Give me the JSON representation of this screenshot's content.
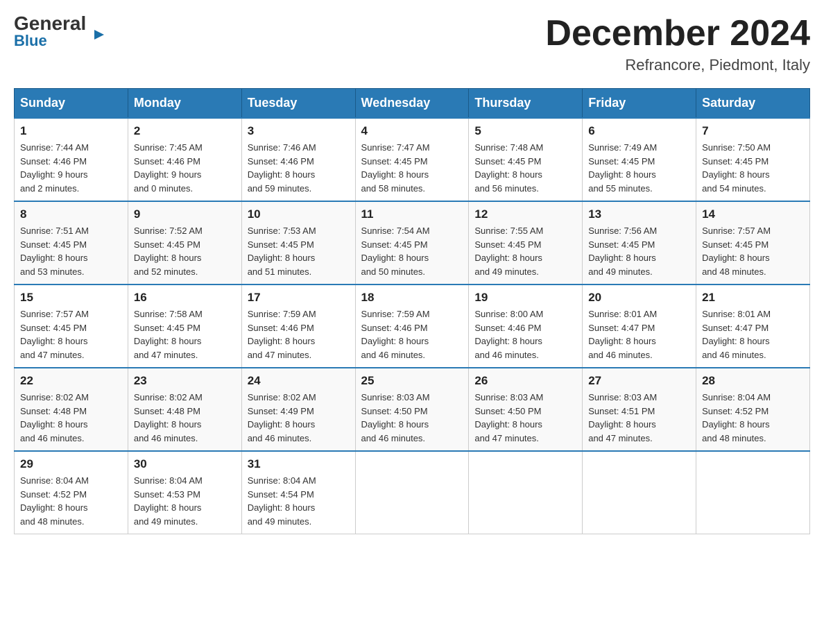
{
  "logo": {
    "brand": "General",
    "brand_blue": "Blue"
  },
  "title": "December 2024",
  "subtitle": "Refrancore, Piedmont, Italy",
  "days": [
    "Sunday",
    "Monday",
    "Tuesday",
    "Wednesday",
    "Thursday",
    "Friday",
    "Saturday"
  ],
  "weeks": [
    [
      {
        "num": "1",
        "sunrise": "7:44 AM",
        "sunset": "4:46 PM",
        "daylight": "9 hours and 2 minutes."
      },
      {
        "num": "2",
        "sunrise": "7:45 AM",
        "sunset": "4:46 PM",
        "daylight": "9 hours and 0 minutes."
      },
      {
        "num": "3",
        "sunrise": "7:46 AM",
        "sunset": "4:46 PM",
        "daylight": "8 hours and 59 minutes."
      },
      {
        "num": "4",
        "sunrise": "7:47 AM",
        "sunset": "4:45 PM",
        "daylight": "8 hours and 58 minutes."
      },
      {
        "num": "5",
        "sunrise": "7:48 AM",
        "sunset": "4:45 PM",
        "daylight": "8 hours and 56 minutes."
      },
      {
        "num": "6",
        "sunrise": "7:49 AM",
        "sunset": "4:45 PM",
        "daylight": "8 hours and 55 minutes."
      },
      {
        "num": "7",
        "sunrise": "7:50 AM",
        "sunset": "4:45 PM",
        "daylight": "8 hours and 54 minutes."
      }
    ],
    [
      {
        "num": "8",
        "sunrise": "7:51 AM",
        "sunset": "4:45 PM",
        "daylight": "8 hours and 53 minutes."
      },
      {
        "num": "9",
        "sunrise": "7:52 AM",
        "sunset": "4:45 PM",
        "daylight": "8 hours and 52 minutes."
      },
      {
        "num": "10",
        "sunrise": "7:53 AM",
        "sunset": "4:45 PM",
        "daylight": "8 hours and 51 minutes."
      },
      {
        "num": "11",
        "sunrise": "7:54 AM",
        "sunset": "4:45 PM",
        "daylight": "8 hours and 50 minutes."
      },
      {
        "num": "12",
        "sunrise": "7:55 AM",
        "sunset": "4:45 PM",
        "daylight": "8 hours and 49 minutes."
      },
      {
        "num": "13",
        "sunrise": "7:56 AM",
        "sunset": "4:45 PM",
        "daylight": "8 hours and 49 minutes."
      },
      {
        "num": "14",
        "sunrise": "7:57 AM",
        "sunset": "4:45 PM",
        "daylight": "8 hours and 48 minutes."
      }
    ],
    [
      {
        "num": "15",
        "sunrise": "7:57 AM",
        "sunset": "4:45 PM",
        "daylight": "8 hours and 47 minutes."
      },
      {
        "num": "16",
        "sunrise": "7:58 AM",
        "sunset": "4:45 PM",
        "daylight": "8 hours and 47 minutes."
      },
      {
        "num": "17",
        "sunrise": "7:59 AM",
        "sunset": "4:46 PM",
        "daylight": "8 hours and 47 minutes."
      },
      {
        "num": "18",
        "sunrise": "7:59 AM",
        "sunset": "4:46 PM",
        "daylight": "8 hours and 46 minutes."
      },
      {
        "num": "19",
        "sunrise": "8:00 AM",
        "sunset": "4:46 PM",
        "daylight": "8 hours and 46 minutes."
      },
      {
        "num": "20",
        "sunrise": "8:01 AM",
        "sunset": "4:47 PM",
        "daylight": "8 hours and 46 minutes."
      },
      {
        "num": "21",
        "sunrise": "8:01 AM",
        "sunset": "4:47 PM",
        "daylight": "8 hours and 46 minutes."
      }
    ],
    [
      {
        "num": "22",
        "sunrise": "8:02 AM",
        "sunset": "4:48 PM",
        "daylight": "8 hours and 46 minutes."
      },
      {
        "num": "23",
        "sunrise": "8:02 AM",
        "sunset": "4:48 PM",
        "daylight": "8 hours and 46 minutes."
      },
      {
        "num": "24",
        "sunrise": "8:02 AM",
        "sunset": "4:49 PM",
        "daylight": "8 hours and 46 minutes."
      },
      {
        "num": "25",
        "sunrise": "8:03 AM",
        "sunset": "4:50 PM",
        "daylight": "8 hours and 46 minutes."
      },
      {
        "num": "26",
        "sunrise": "8:03 AM",
        "sunset": "4:50 PM",
        "daylight": "8 hours and 47 minutes."
      },
      {
        "num": "27",
        "sunrise": "8:03 AM",
        "sunset": "4:51 PM",
        "daylight": "8 hours and 47 minutes."
      },
      {
        "num": "28",
        "sunrise": "8:04 AM",
        "sunset": "4:52 PM",
        "daylight": "8 hours and 48 minutes."
      }
    ],
    [
      {
        "num": "29",
        "sunrise": "8:04 AM",
        "sunset": "4:52 PM",
        "daylight": "8 hours and 48 minutes."
      },
      {
        "num": "30",
        "sunrise": "8:04 AM",
        "sunset": "4:53 PM",
        "daylight": "8 hours and 49 minutes."
      },
      {
        "num": "31",
        "sunrise": "8:04 AM",
        "sunset": "4:54 PM",
        "daylight": "8 hours and 49 minutes."
      },
      null,
      null,
      null,
      null
    ]
  ],
  "labels": {
    "sunrise": "Sunrise:",
    "sunset": "Sunset:",
    "daylight": "Daylight:"
  }
}
